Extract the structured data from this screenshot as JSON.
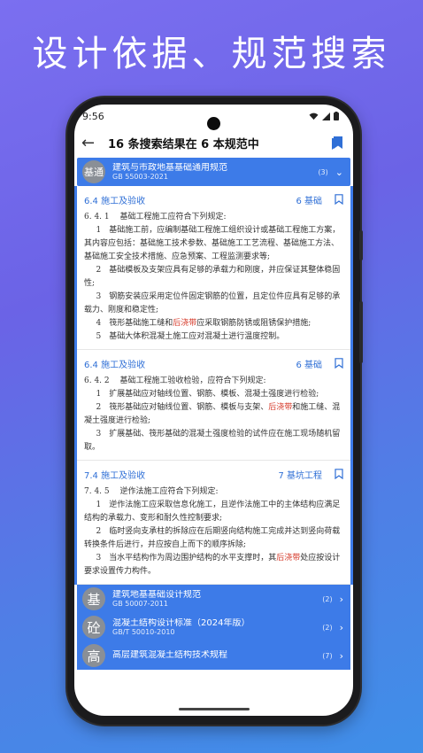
{
  "headline": "设计依据、规范搜索",
  "status": {
    "time": "9:56"
  },
  "appbar": {
    "title": "16 条搜索结果在 6 本规范中"
  },
  "top_spec": {
    "seal": "基通",
    "name": "建筑与市政地基基础通用规范",
    "code": "GB 55003-2021",
    "count": "(3)"
  },
  "results": [
    {
      "section": "6.4 施工及验收",
      "chapter": "6 基础",
      "lead": "6. 4. 1　 基础工程施工应符合下列规定:",
      "items": [
        "1　基础施工前，应编制基础工程施工组织设计或基础工程施工方案，其内容应包括：基础施工技术参数、基础施工工艺流程、基础施工方法、基础施工安全技术措施、应急预案、工程监测要求等;",
        "2　基础模板及支架应具有足够的承载力和刚度，并应保证其整体稳固性;",
        "3　钢筋安装应采用定位件固定钢筋的位置，且定位件应具有足够的承载力、刚度和稳定性;"
      ],
      "item4_pre": "4　筏形基础施工缝和",
      "item4_hl": "后浇带",
      "item4_post": "应采取钢筋防锈或阻锈保护措施;",
      "item5": "5　基础大体积混凝土施工应对混凝土进行温度控制。"
    },
    {
      "section": "6.4 施工及验收",
      "chapter": "6 基础",
      "lead": "6. 4. 2　 基础工程施工验收检验，应符合下列规定:",
      "item1": "1　扩展基础应对轴线位置、钢筋、模板、混凝土强度进行检验;",
      "item2_pre": "2　筏形基础应对轴线位置、钢筋、模板与支架、",
      "item2_hl": "后浇带",
      "item2_post": "和施工缝、混凝土强度进行检验;",
      "item3": "3　扩展基础、筏形基础的混凝土强度检验的试件应在施工现场随机留取。"
    },
    {
      "section": "7.4 施工及验收",
      "chapter": "7 基坑工程",
      "lead": "7. 4. 5　 逆作法施工应符合下列规定:",
      "item1": "1　逆作法施工应采取信息化施工，且逆作法施工中的主体结构应满足结构的承载力、变形和耐久性控制要求;",
      "item2": "2　临时竖向支承柱的拆除应在后期竖向结构施工完成并达到竖向荷载转换条件后进行，并应按自上而下的顺序拆除;",
      "item3_pre": "3　当水平结构作为周边围护结构的水平支撑时，其",
      "item3_hl1": "后浇",
      "item3_hl2": "带",
      "item3_post": "处应按设计要求设置传力构件。"
    }
  ],
  "specs": [
    {
      "seal": "基",
      "name": "建筑地基基础设计规范",
      "code": "GB 50007-2011",
      "count": "(2)"
    },
    {
      "seal": "砼",
      "name": "混凝土结构设计标准（2024年版）",
      "code": "GB/T 50010-2010",
      "count": "(2)"
    },
    {
      "seal": "高",
      "name": "高层建筑混凝土结构技术规程",
      "code": "",
      "count": "(7)"
    }
  ]
}
